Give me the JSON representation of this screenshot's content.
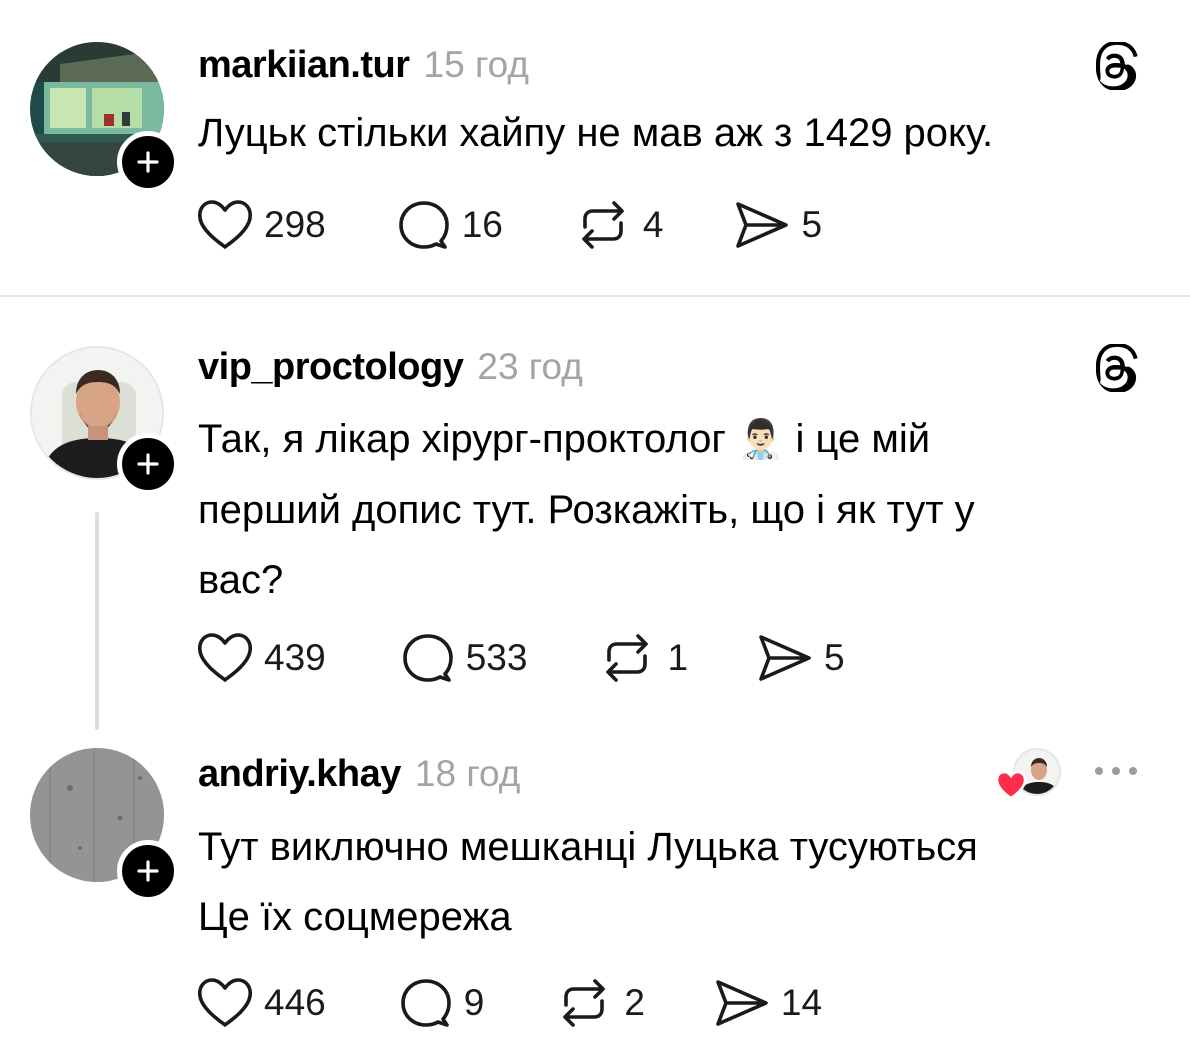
{
  "posts": [
    {
      "username": "markiian.tur",
      "time": "15 год",
      "text": "Луцьк стільки хайпу не мав аж з 1429 року.",
      "likes": "298",
      "replies": "16",
      "reposts": "4",
      "shares": "5"
    },
    {
      "username": "vip_proctology",
      "time": "23 год",
      "text_part1": "Так, я лікар хірург-проктолог",
      "emoji": "👨🏻‍⚕️",
      "text_part2": " і це мій",
      "text_rest": "перший допис тут. Розкажіть, що і як тут у\nвас?",
      "likes": "439",
      "replies": "533",
      "reposts": "1",
      "shares": "5"
    },
    {
      "username": "andriy.khay",
      "time": "18 год",
      "text": "Тут виключно мешканці Луцька тусуються\nЦе їх соцмережа",
      "likes": "446",
      "replies": "9",
      "reposts": "2",
      "shares": "14"
    }
  ],
  "colors": {
    "accent_like": "#ff2d4b",
    "muted_text": "#a4a4a4",
    "divider": "#e8e8e8"
  },
  "icons": [
    "threads-logo-icon",
    "heart-icon",
    "reply-icon",
    "repost-icon",
    "share-icon",
    "plus-icon",
    "more-icon"
  ]
}
